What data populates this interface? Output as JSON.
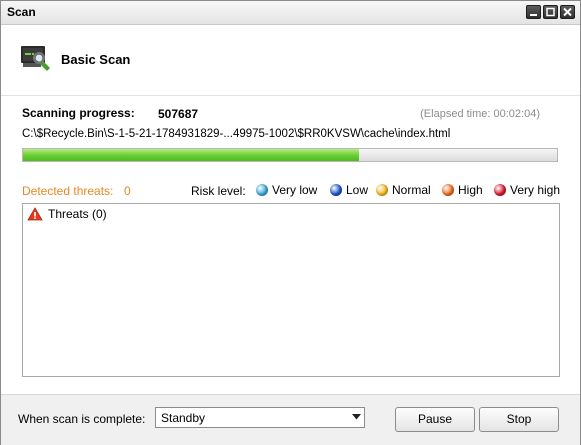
{
  "window": {
    "title": "Scan"
  },
  "header": {
    "title": "Basic Scan"
  },
  "progress": {
    "label": "Scanning progress:",
    "count": "507687",
    "elapsed": "(Elapsed time: 00:02:04)",
    "current_path": "C:\\$Recycle.Bin\\S-1-5-21-1784931829-...49975-1002\\$RR0KVSW\\cache\\index.html",
    "fraction": 0.63
  },
  "threats": {
    "label": "Detected threats:",
    "count": "0",
    "tree_root": "Threats (0)"
  },
  "risk": {
    "label": "Risk level:",
    "levels": [
      {
        "label": "Very low",
        "color": "#3aa8dc"
      },
      {
        "label": "Low",
        "color": "#1f55c8"
      },
      {
        "label": "Normal",
        "color": "#f2b81b"
      },
      {
        "label": "High",
        "color": "#ef6a1f"
      },
      {
        "label": "Very high",
        "color": "#d9182b"
      }
    ]
  },
  "footer": {
    "when_label": "When scan is complete:",
    "when_value": "Standby",
    "pause_label": "Pause",
    "stop_label": "Stop"
  },
  "colors": {
    "accent_orange": "#e8891f",
    "progress_green": "#6dcf35"
  },
  "icons": [
    "scanner-icon",
    "minimize-icon",
    "maximize-icon",
    "close-icon",
    "warning-icon",
    "dropdown-arrow-icon"
  ]
}
